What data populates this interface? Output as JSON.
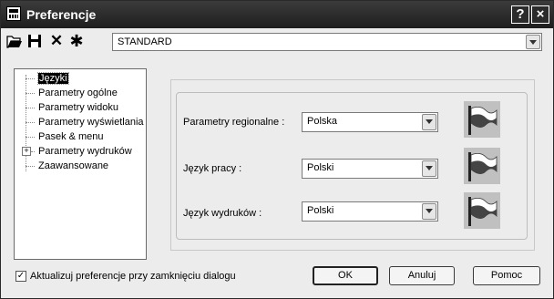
{
  "window": {
    "title": "Preferencje",
    "help_glyph": "?",
    "close_glyph": "×"
  },
  "toolbar": {
    "icons": [
      "open-folder-icon",
      "save-icon",
      "delete-icon",
      "new-star-icon"
    ],
    "delete_glyph": "✕",
    "new_glyph": "✱",
    "profile": "STANDARD"
  },
  "tree": {
    "items": [
      {
        "label": "Języki",
        "selected": true
      },
      {
        "label": "Parametry ogólne"
      },
      {
        "label": "Parametry widoku"
      },
      {
        "label": "Parametry wyświetlania"
      },
      {
        "label": "Pasek & menu"
      },
      {
        "label": "Parametry wydruków",
        "expandable": true
      },
      {
        "label": "Zaawansowane"
      }
    ],
    "expander_glyph": "+"
  },
  "settings": {
    "regional": {
      "label": "Parametry regionalne :",
      "value": "Polska"
    },
    "work_language": {
      "label": "Język pracy :",
      "value": "Polski"
    },
    "print_language": {
      "label": "Język wydruków :",
      "value": "Polski"
    }
  },
  "footer": {
    "checkbox_label": "Aktualizuj preferencje przy zamknięciu dialogu",
    "checkbox_checked": true,
    "check_glyph": "✓",
    "ok": "OK",
    "cancel": "Anuluj",
    "help": "Pomoc"
  },
  "colors": {
    "titlebar": "#1e1e1e",
    "flag_bg": "#c0c0c0",
    "selection": "#000000"
  }
}
